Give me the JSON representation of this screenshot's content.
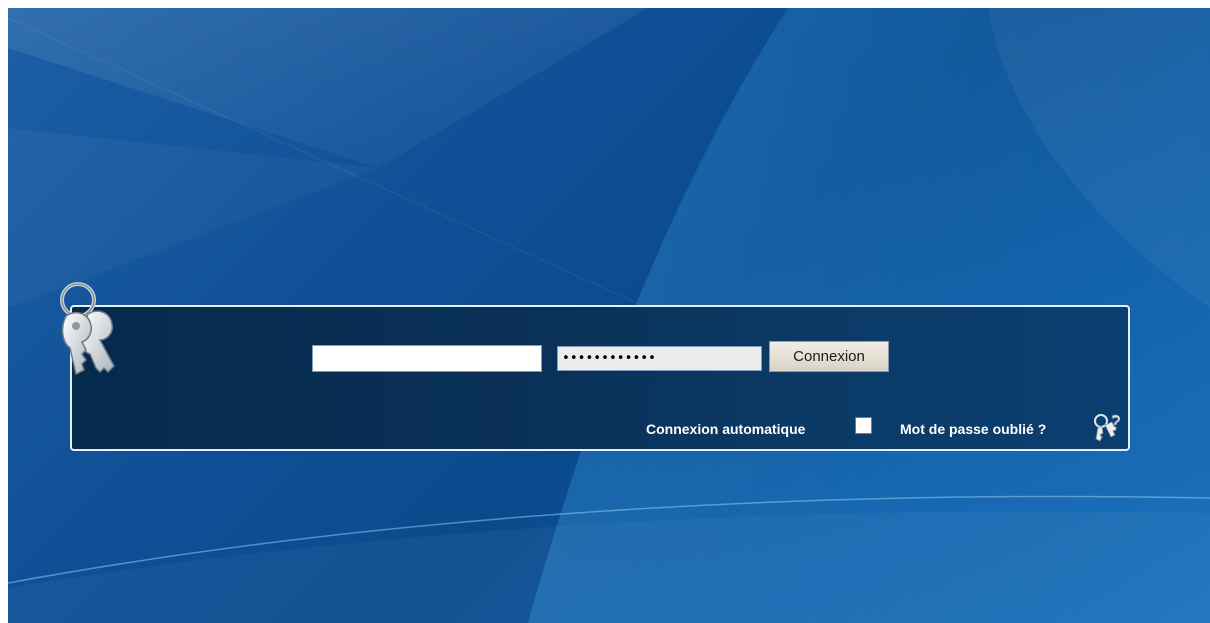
{
  "login": {
    "username_value": "",
    "password_value": "••••••••••••",
    "submit_label": "Connexion",
    "auto_login_label": "Connexion automatique",
    "auto_login_checked": false,
    "forgot_password_label": "Mot de passe oublié ?"
  },
  "icons": {
    "keys": "keys-icon",
    "forgot": "keys-question-icon"
  },
  "colors": {
    "background": "#0f4f96",
    "panel": "#0a3158",
    "panel_border": "#e8eef5",
    "text": "#ffffff"
  }
}
